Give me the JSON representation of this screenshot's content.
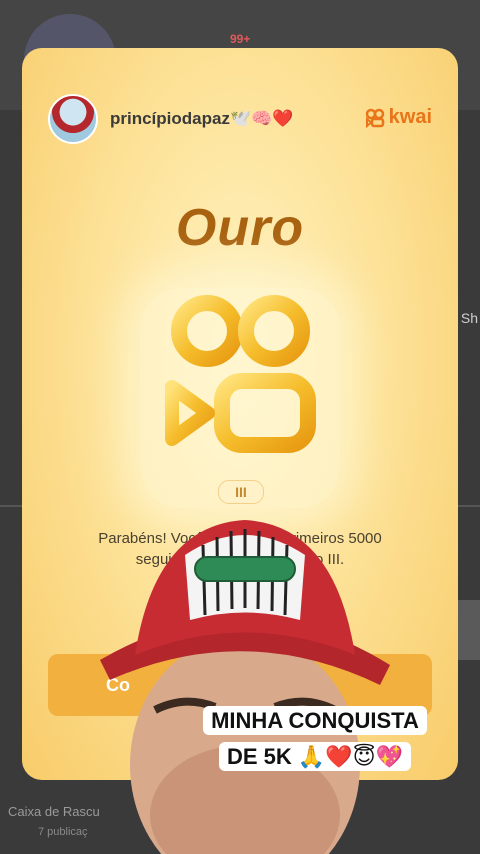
{
  "background": {
    "badge": "99+",
    "side_text": "Sh",
    "folder_label": "Caixa de Rascu",
    "folder_sub": "7 publicaç"
  },
  "card": {
    "username": "princípiodapaz🕊️🧠❤️",
    "brand": "kwai",
    "tier_title": "Ouro",
    "level": "III",
    "congrats_text": "Parabéns! Você co... primeiros 5000 seguidore... ro III.",
    "congrats_line1": "Parabéns! Você co              primeiros 5000",
    "congrats_line2": "seguidore                          ro III.",
    "action_label": "Co"
  },
  "caption": {
    "line1": "MINHA CONQUISTA",
    "line2": "DE 5K 🙏❤️😇💖"
  },
  "colors": {
    "brand_orange": "#e8751a",
    "gold_title": "#a9620f",
    "button": "#f2b13e"
  }
}
